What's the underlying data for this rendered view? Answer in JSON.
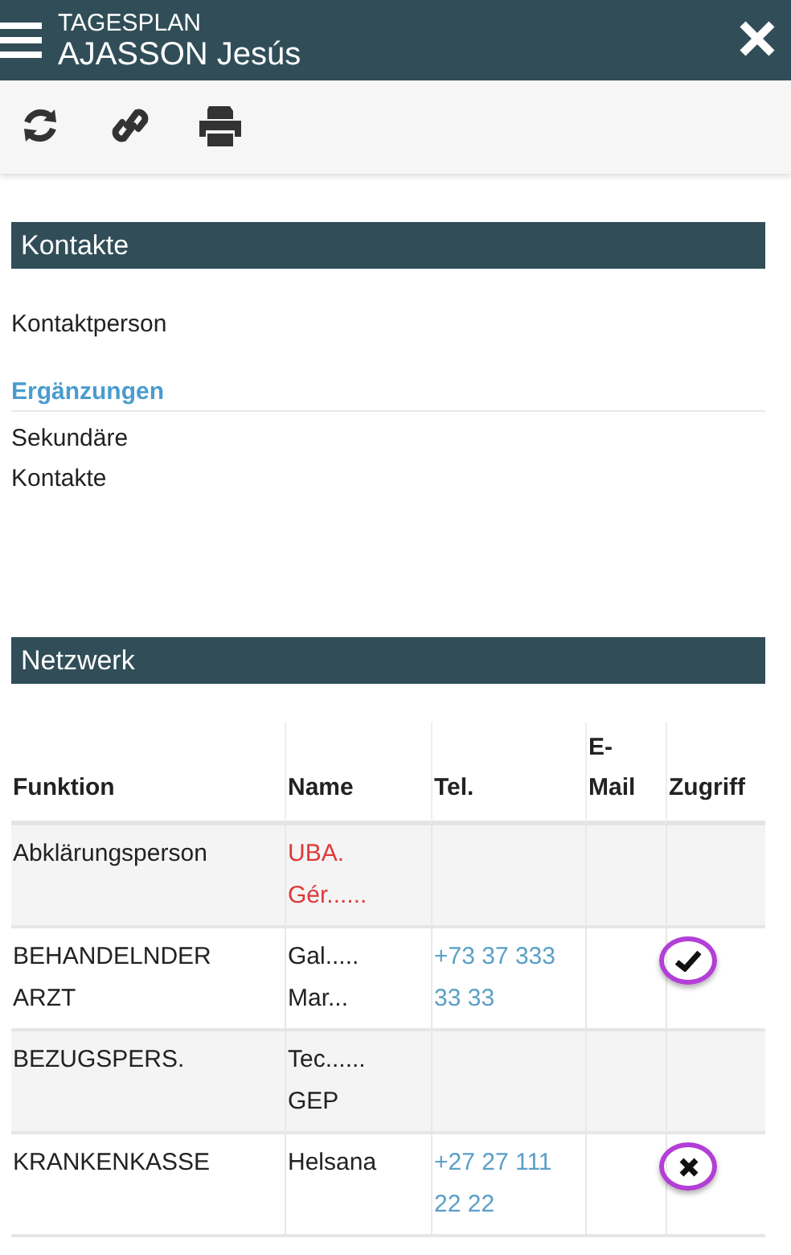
{
  "header": {
    "subtitle": "TAGESPLAN",
    "title": "AJASSON Jesús"
  },
  "toolbar": [
    {
      "kind": "refresh"
    },
    {
      "kind": "link"
    },
    {
      "kind": "print"
    }
  ],
  "kontakte": {
    "title": "Kontakte",
    "contact_label": "Kontaktperson",
    "supplement_title": "Ergänzungen",
    "supplement_text": "Sekundäre Kontakte"
  },
  "netzwerk": {
    "title": "Netzwerk",
    "columns": [
      "Funktion",
      "Name",
      "Tel.",
      "E-Mail",
      "Zugriff"
    ],
    "rows": [
      {
        "function": "Abklärungsperson",
        "name": "UBA. Gér......",
        "name_flagged": true,
        "access_marker": false
      },
      {
        "function": "BEHANDELNDER ARZT",
        "name": "Gal..... Mar...",
        "name_flagged": false,
        "phone": "+73 37 333 33 33",
        "access_marker": true,
        "access_granted": true
      },
      {
        "function": "BEZUGSPERS.",
        "name": "Tec...... GEP",
        "name_flagged": false,
        "access_marker": false
      },
      {
        "function": "KRANKENKASSE",
        "name": "Helsana",
        "name_flagged": false,
        "phone": "+27 27 111 22 22",
        "access_marker": true,
        "access_granted": false
      }
    ]
  }
}
